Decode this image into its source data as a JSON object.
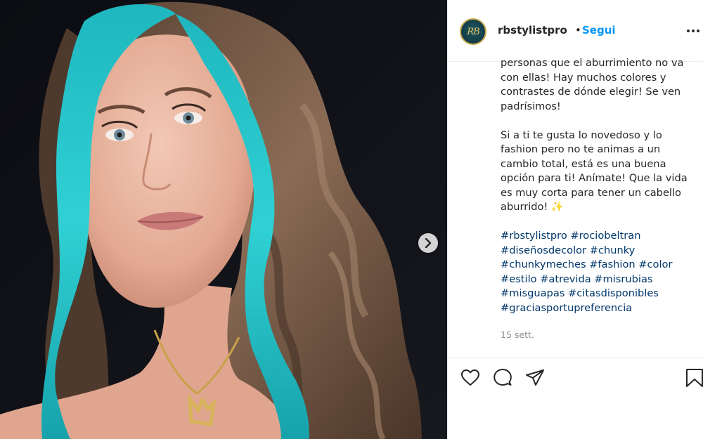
{
  "post": {
    "username": "rbstylistpro",
    "separator": "•",
    "follow_label": "Segui",
    "avatar_text": "RB",
    "caption_lines_1": [
      "personas que el aburrimiento no va",
      "con ellas! Hay muchos colores y",
      "contrastes de dónde elegir! Se ven",
      "padrísimos!"
    ],
    "caption_lines_2": [
      "Si a ti te gusta lo novedoso y lo",
      "fashion pero no te animas a un",
      "cambio total, está es una buena",
      "opción para ti! Anímate! Que la vida",
      "es muy corta para tener un cabello",
      "aburrido! ✨"
    ],
    "hashtag_lines": [
      "#rbstylistpro #rociobeltran",
      "#diseñosdecolor #chunky",
      "#chunkymeches #fashion #color",
      "#estilo #atrevida #misrubias",
      "#misguapas #citasdisponibles",
      "#graciasportupreferencia"
    ],
    "date": "15 sett."
  },
  "icons": {
    "next": "chevron-right-icon",
    "more": "more-options-icon",
    "like": "heart-icon",
    "comment": "comment-icon",
    "share": "paper-plane-icon",
    "save": "bookmark-icon"
  },
  "colors": {
    "follow": "#0095f6",
    "hashtag": "#00376b",
    "hair_teal": "#22c3c9",
    "hair_brown": "#6b5140",
    "background_dark": "#0f1116"
  }
}
